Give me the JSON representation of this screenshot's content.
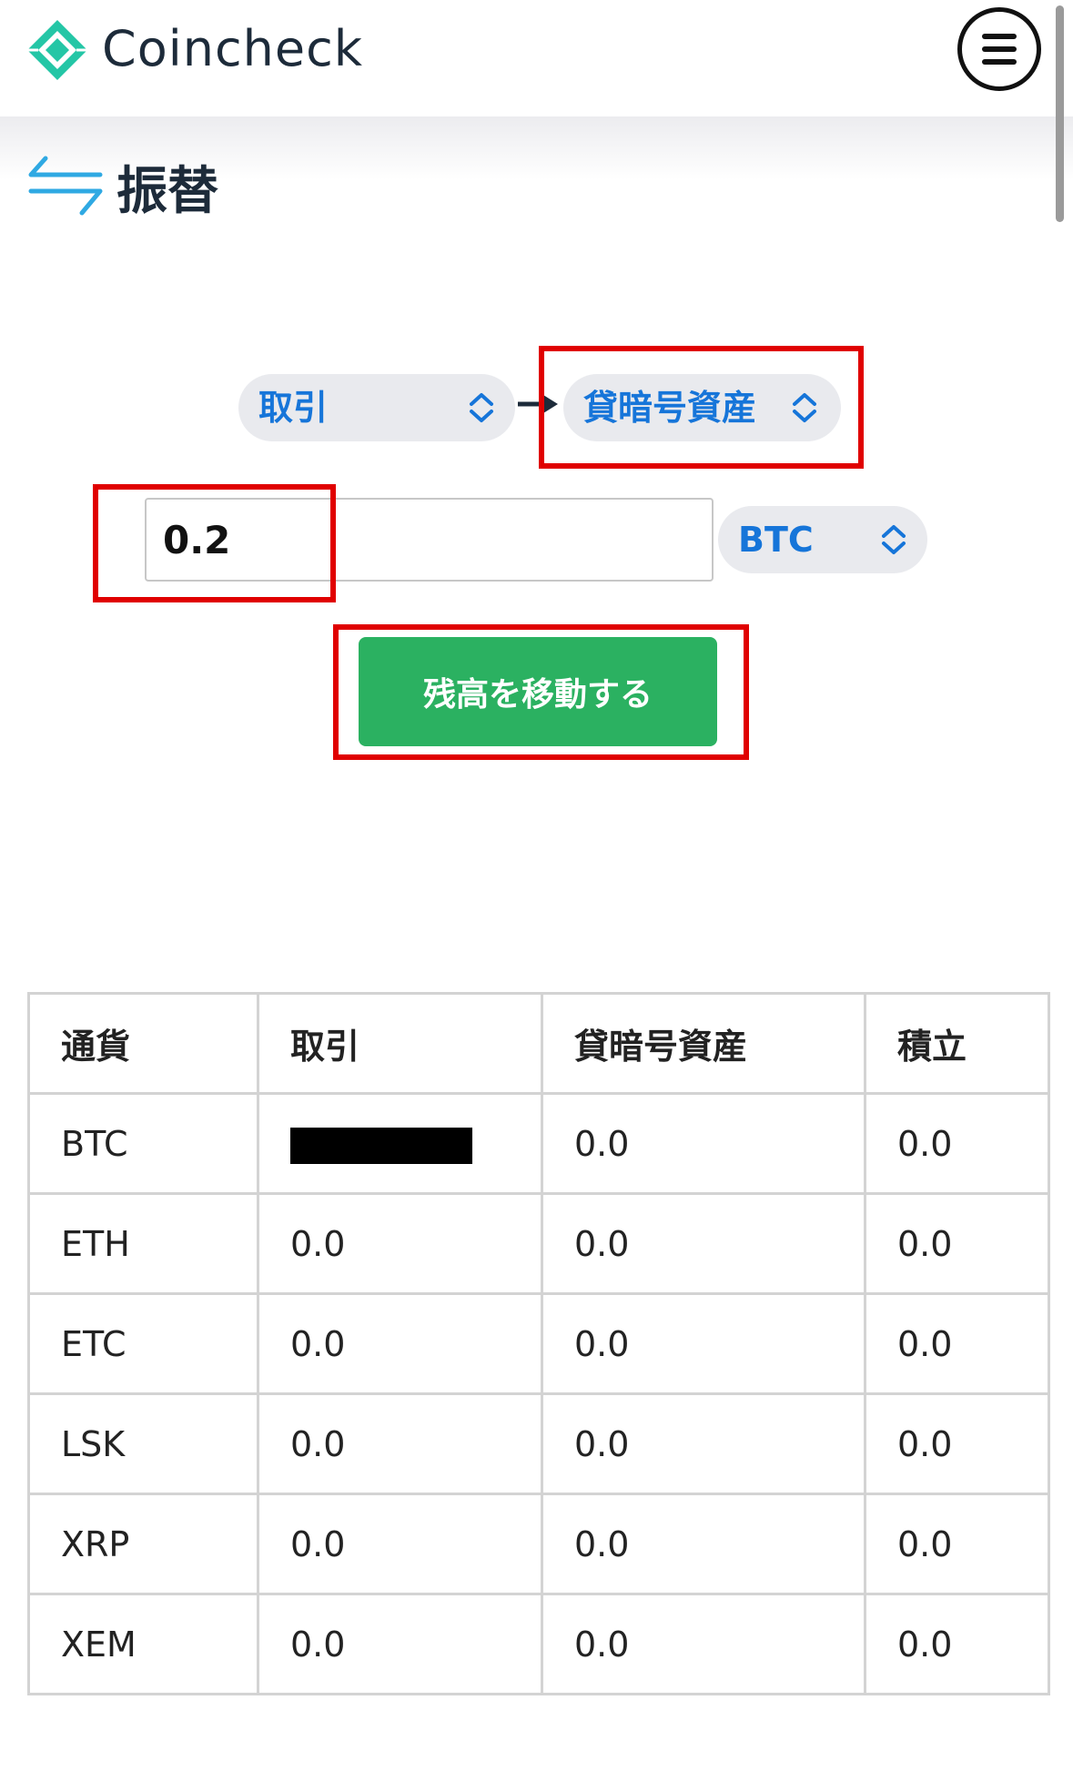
{
  "header": {
    "brand": "Coincheck",
    "brand_color": "#24c6a6",
    "menu_icon": "hamburger-icon"
  },
  "page": {
    "title": "振替",
    "icon": "transfer-arrows-icon"
  },
  "transfer": {
    "from_account": "取引",
    "to_account": "貸暗号資産",
    "amount": "0.2",
    "currency": "BTC",
    "submit_label": "残高を移動する",
    "accent_color": "#1675d9",
    "button_color": "#2bb161"
  },
  "table": {
    "headers": [
      "通貨",
      "取引",
      "貸暗号資産",
      "積立"
    ],
    "rows": [
      {
        "currency": "BTC",
        "trade": "",
        "lending": "0.0",
        "saving": "0.0",
        "trade_redacted": true
      },
      {
        "currency": "ETH",
        "trade": "0.0",
        "lending": "0.0",
        "saving": "0.0"
      },
      {
        "currency": "ETC",
        "trade": "0.0",
        "lending": "0.0",
        "saving": "0.0"
      },
      {
        "currency": "LSK",
        "trade": "0.0",
        "lending": "0.0",
        "saving": "0.0"
      },
      {
        "currency": "XRP",
        "trade": "0.0",
        "lending": "0.0",
        "saving": "0.0"
      },
      {
        "currency": "XEM",
        "trade": "0.0",
        "lending": "0.0",
        "saving": "0.0"
      }
    ]
  }
}
